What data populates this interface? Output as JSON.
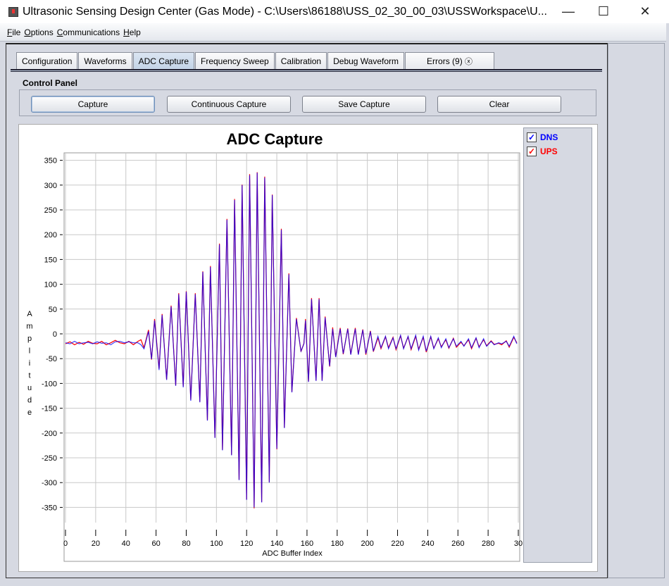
{
  "window": {
    "title": "Ultrasonic Sensing Design Center (Gas Mode) - C:\\Users\\86188\\USS_02_30_00_03\\USSWorkspace\\U...",
    "minimize": "—",
    "maximize": "☐",
    "close": "✕"
  },
  "menu": [
    "File",
    "Options",
    "Communications",
    "Help"
  ],
  "tabs": [
    {
      "label": "Configuration"
    },
    {
      "label": "Waveforms"
    },
    {
      "label": "ADC Capture",
      "active": true
    },
    {
      "label": "Frequency Sweep"
    },
    {
      "label": "Calibration"
    },
    {
      "label": "Debug Waveform"
    },
    {
      "label": "Errors (9)",
      "close": "ⓧ"
    }
  ],
  "control_panel": {
    "label": "Control Panel",
    "buttons": [
      "Capture",
      "Continuous Capture",
      "Save Capture",
      "Clear"
    ]
  },
  "legend": [
    {
      "name": "DNS",
      "color": "#0000ff",
      "checked": true
    },
    {
      "name": "UPS",
      "color": "#ff0000",
      "checked": true
    }
  ],
  "chart_data": {
    "type": "line",
    "title": "ADC Capture",
    "xlabel": "ADC Buffer Index",
    "ylabel": "Amplitude",
    "xlim": [
      0,
      300
    ],
    "ylim": [
      -350,
      350
    ],
    "grid": true,
    "legend_placement": "right",
    "xticks": [
      0,
      20,
      40,
      60,
      80,
      100,
      120,
      140,
      160,
      180,
      200,
      220,
      240,
      260,
      280,
      300
    ],
    "xtick_labels": [
      "0",
      "20",
      "40",
      "60",
      "80",
      "100",
      "120",
      "140",
      "160",
      "180",
      "200",
      "220",
      "240",
      "260",
      "280",
      "30"
    ],
    "yticks": [
      350,
      300,
      250,
      200,
      150,
      100,
      50,
      0,
      -50,
      -100,
      -150,
      -200,
      -250,
      -300,
      -350
    ],
    "x": [
      0,
      3,
      6,
      9,
      12,
      15,
      18,
      21,
      24,
      27,
      30,
      33,
      36,
      39,
      42,
      45,
      48,
      50,
      52,
      55,
      57,
      59,
      62,
      64,
      67,
      70,
      73,
      75,
      78,
      80,
      83,
      86,
      89,
      91,
      94,
      96,
      99,
      102,
      104,
      107,
      110,
      112,
      115,
      117,
      120,
      122,
      125,
      127,
      130,
      132,
      135,
      137,
      140,
      143,
      145,
      148,
      150,
      153,
      156,
      158,
      159,
      161,
      163,
      166,
      168,
      170,
      172,
      175,
      177,
      179,
      182,
      184,
      187,
      189,
      192,
      194,
      197,
      199,
      202,
      204,
      207,
      209,
      212,
      214,
      217,
      219,
      222,
      224,
      227,
      229,
      232,
      234,
      237,
      239,
      242,
      244,
      247,
      249,
      252,
      254,
      257,
      259,
      262,
      264,
      267,
      269,
      272,
      274,
      277,
      279,
      282,
      284,
      287,
      289,
      292,
      294,
      297,
      299
    ],
    "series": [
      {
        "name": "DNS",
        "color": "#0000ff",
        "y": [
          -18,
          -20,
          -15,
          -20,
          -18,
          -17,
          -20,
          -16,
          -19,
          -18,
          -22,
          -16,
          -15,
          -18,
          -16,
          -18,
          -18,
          -22,
          -30,
          5,
          -51,
          27,
          -73,
          38,
          -93,
          55,
          -105,
          80,
          -108,
          85,
          -135,
          80,
          -138,
          125,
          -175,
          135,
          -210,
          180,
          -235,
          230,
          -245,
          270,
          -295,
          300,
          -335,
          320,
          -350,
          325,
          -340,
          315,
          -300,
          280,
          -232,
          210,
          -190,
          120,
          -118,
          30,
          -35,
          -20,
          27,
          -97,
          70,
          -95,
          70,
          -95,
          33,
          -65,
          10,
          -47,
          10,
          -40,
          10,
          -42,
          10,
          -42,
          8,
          -40,
          5,
          -35,
          -5,
          -28,
          -5,
          -30,
          -8,
          -30,
          -3,
          -30,
          -5,
          -30,
          -3,
          -33,
          -5,
          -35,
          -5,
          -30,
          -8,
          -28,
          -10,
          -28,
          -10,
          -25,
          -15,
          -25,
          -10,
          -28,
          -8,
          -28,
          -10,
          -25,
          -15,
          -22,
          -18,
          -20,
          -15,
          -25,
          -5,
          -20
        ]
      },
      {
        "name": "UPS",
        "color": "#ff0000",
        "y": [
          -20,
          -16,
          -22,
          -17,
          -21,
          -15,
          -19,
          -20,
          -15,
          -22,
          -18,
          -13,
          -18,
          -20,
          -15,
          -22,
          -15,
          -12,
          -28,
          8,
          -52,
          30,
          -70,
          40,
          -92,
          57,
          -104,
          82,
          -106,
          86,
          -133,
          82,
          -137,
          126,
          -174,
          137,
          -209,
          182,
          -234,
          232,
          -244,
          272,
          -294,
          301,
          -334,
          322,
          -352,
          326,
          -339,
          317,
          -299,
          281,
          -233,
          212,
          -189,
          122,
          -117,
          32,
          -36,
          -19,
          30,
          -96,
          72,
          -94,
          72,
          -94,
          35,
          -66,
          13,
          -46,
          12,
          -41,
          11,
          -41,
          12,
          -41,
          9,
          -42,
          6,
          -36,
          -8,
          -30,
          -6,
          -28,
          -7,
          -32,
          -4,
          -29,
          -6,
          -32,
          -5,
          -31,
          -7,
          -37,
          -6,
          -29,
          -10,
          -26,
          -12,
          -29,
          -9,
          -27,
          -17,
          -24,
          -12,
          -30,
          -9,
          -26,
          -12,
          -24,
          -14,
          -21,
          -19,
          -22,
          -14,
          -27,
          -7,
          -18
        ]
      }
    ]
  }
}
